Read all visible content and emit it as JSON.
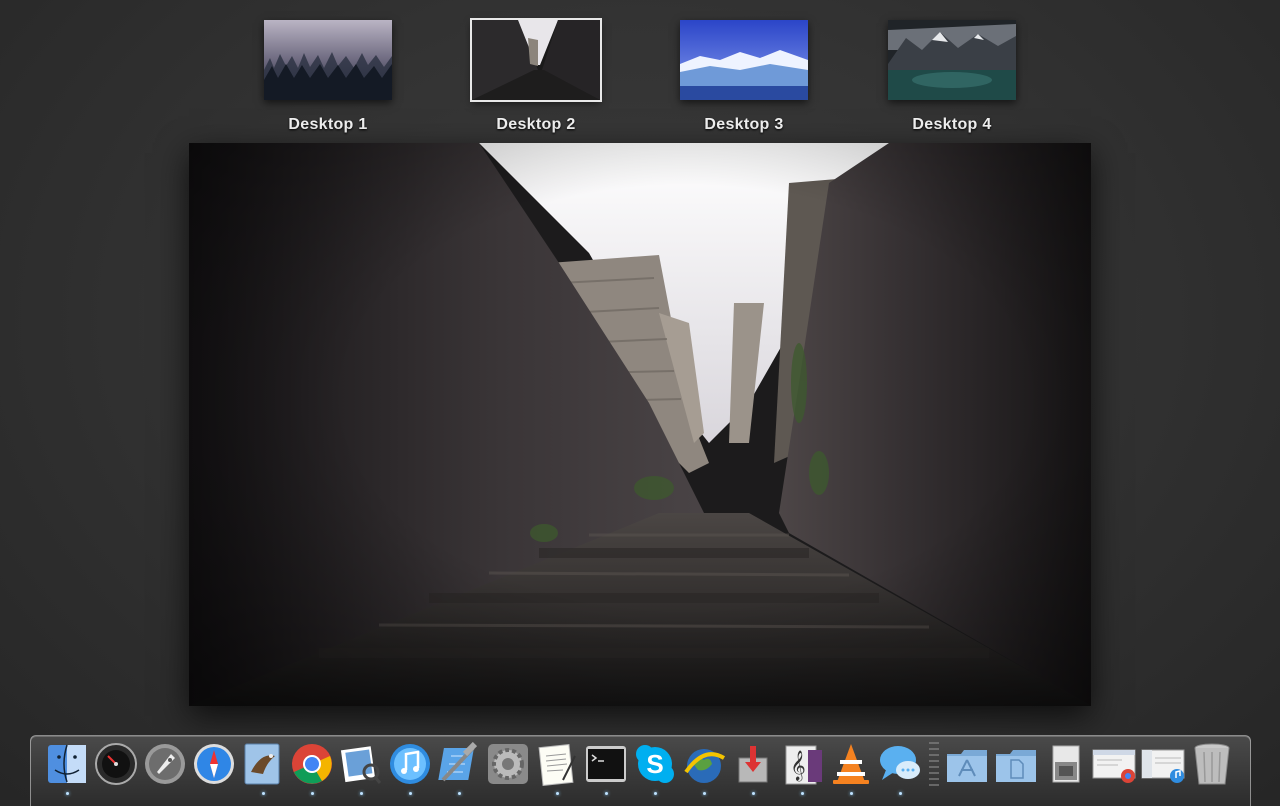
{
  "spaces": [
    {
      "label": "Desktop 1",
      "active": false
    },
    {
      "label": "Desktop 2",
      "active": true
    },
    {
      "label": "Desktop 3",
      "active": false
    },
    {
      "label": "Desktop 4",
      "active": false
    }
  ],
  "dock": {
    "apps": [
      {
        "name": "finder-icon",
        "running": true
      },
      {
        "name": "dashboard-icon",
        "running": false
      },
      {
        "name": "launchpad-icon",
        "running": false
      },
      {
        "name": "safari-icon",
        "running": false
      },
      {
        "name": "mail-icon",
        "running": true
      },
      {
        "name": "chrome-icon",
        "running": true
      },
      {
        "name": "preview-icon",
        "running": true
      },
      {
        "name": "itunes-icon",
        "running": true
      },
      {
        "name": "xcode-icon",
        "running": true
      },
      {
        "name": "system-preferences-icon",
        "running": false
      },
      {
        "name": "textedit-icon",
        "running": true
      },
      {
        "name": "terminal-icon",
        "running": true
      },
      {
        "name": "skype-icon",
        "running": true
      },
      {
        "name": "google-earth-icon",
        "running": true
      },
      {
        "name": "installer-icon",
        "running": true
      },
      {
        "name": "sheet-music-icon",
        "running": true
      },
      {
        "name": "vlc-icon",
        "running": true
      },
      {
        "name": "messages-icon",
        "running": true
      }
    ],
    "stacks": [
      {
        "name": "applications-folder-icon"
      },
      {
        "name": "documents-folder-icon"
      },
      {
        "name": "downloads-stack-icon"
      },
      {
        "name": "chrome-window-icon"
      },
      {
        "name": "itunes-window-icon"
      },
      {
        "name": "trash-icon"
      }
    ]
  }
}
